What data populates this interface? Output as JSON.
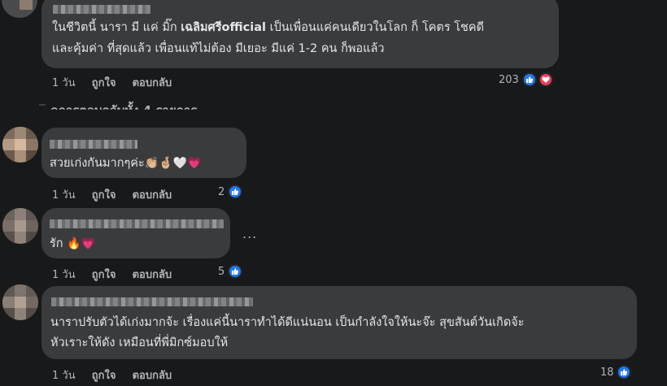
{
  "comments": [
    {
      "text_lines": [
        "ในชีวิตนี้ นารา มี แค่ มิ๊ก เฉลิมศรีofficial เป็นเพื่อนแค่คนเดียวในโลก ก็ โคตร โชคดี",
        "และคุ้มค่า ที่สุดแล้ว เพื่อนแท้ไม่ต้อง มีเยอะ มีแค่ 1-2 คน ก็พอแล้ว"
      ],
      "mention": "เฉลิมศรีofficial",
      "time": "1 วัน",
      "like_label": "ถูกใจ",
      "reply_label": "ตอบกลับ",
      "reaction_count": "203",
      "reactions": [
        "like-icon",
        "love-icon"
      ]
    },
    {
      "text": "สวยเก่งกันมากๆค่ะ",
      "emojis": "👏🏼🤞🏼🤍💗",
      "time": "1 วัน",
      "like_label": "ถูกใจ",
      "reply_label": "ตอบกลับ",
      "reaction_count": "2",
      "reactions": [
        "like-icon"
      ]
    },
    {
      "text": "รัก",
      "emojis": "🔥💗",
      "time": "1 วัน",
      "like_label": "ถูกใจ",
      "reply_label": "ตอบกลับ",
      "reaction_count": "5",
      "reactions": [
        "like-icon"
      ],
      "more": "..."
    },
    {
      "text_lines": [
        "นาราปรับตัวได้เก่งมากจ้ะ เรื่องแค่นี้นาราทำได้ดีแน่นอน เป็นกำลังใจให้นะจ๊ะ สุขสันต์วันเกิดจ้ะ",
        "หัวเราะให้ดัง เหมือนที่พี่มิกซ์มอบให้"
      ],
      "time": "1 วัน",
      "like_label": "ถูกใจ",
      "reply_label": "ตอบกลับ",
      "reaction_count": "18",
      "reactions": [
        "like-icon"
      ]
    }
  ],
  "replies_link": "ดูการตอบกลับทั้ง 4 รายการ",
  "colors": {
    "background": "#18191a",
    "bubble": "#3a3b3c",
    "text": "#e4e6eb",
    "secondary": "#b0b3b8",
    "like_blue": "#2078f4",
    "love_red": "#f33e58"
  }
}
